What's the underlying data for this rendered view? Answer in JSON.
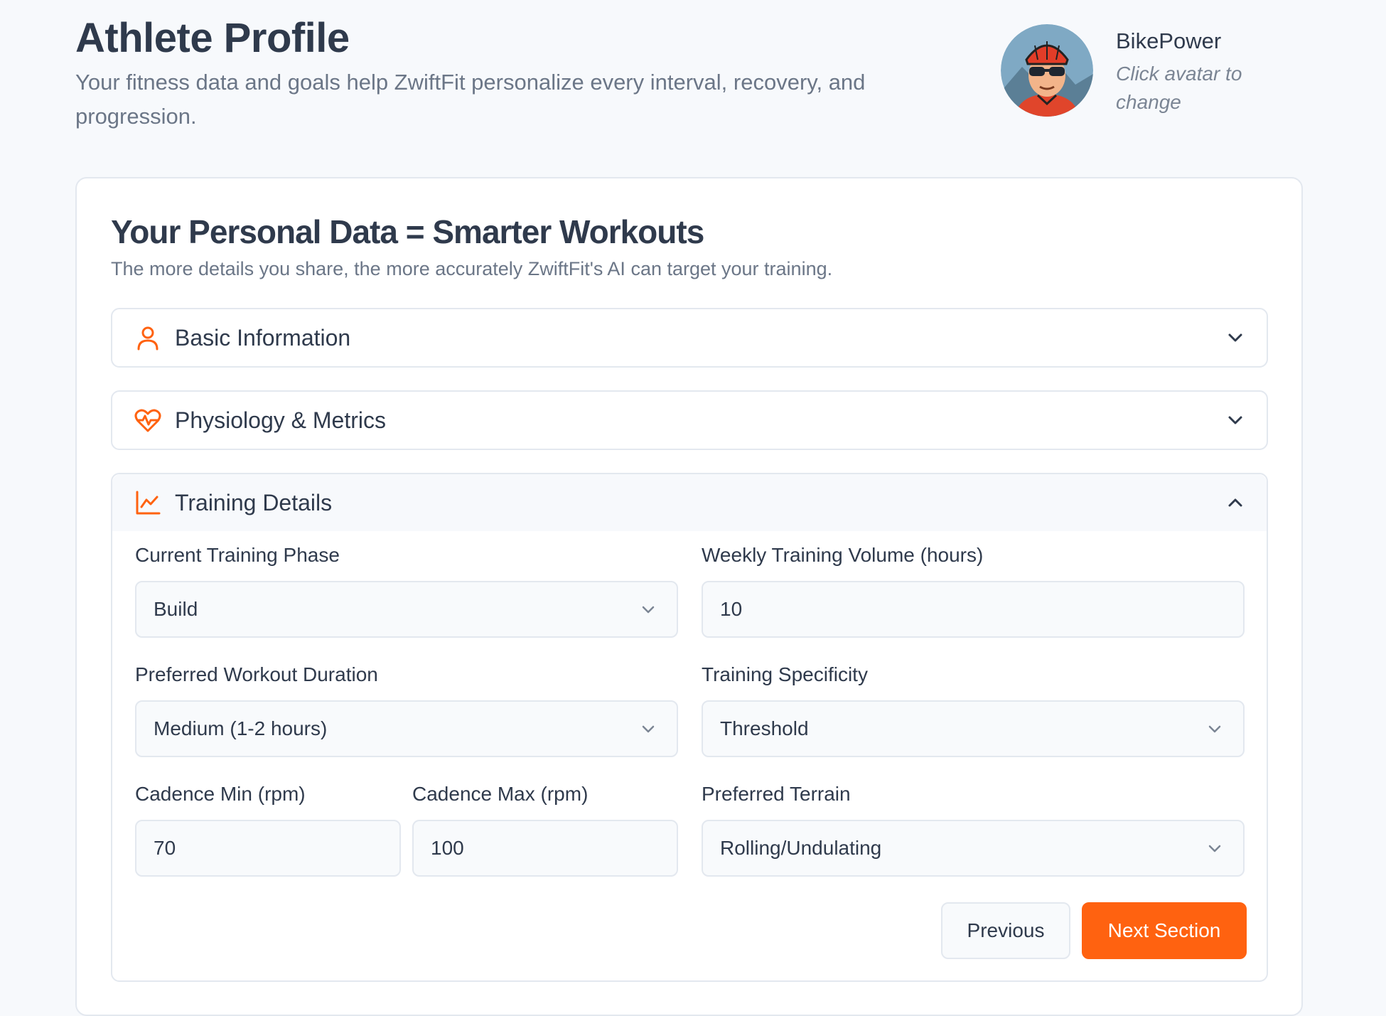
{
  "header": {
    "title": "Athlete Profile",
    "subtitle": "Your fitness data and goals help ZwiftFit personalize every interval, recovery, and progression."
  },
  "profile": {
    "username": "BikePower",
    "avatar_hint": "Click avatar to change"
  },
  "card": {
    "title": "Your Personal Data = Smarter Workouts",
    "subtitle": "The more details you share, the more accurately ZwiftFit's AI can target your training."
  },
  "sections": {
    "basic": {
      "label": "Basic Information",
      "icon": "user-icon",
      "expanded": false
    },
    "physiology": {
      "label": "Physiology & Metrics",
      "icon": "heart-pulse-icon",
      "expanded": false
    },
    "training": {
      "label": "Training Details",
      "icon": "line-chart-icon",
      "expanded": true
    }
  },
  "training": {
    "phase": {
      "label": "Current Training Phase",
      "value": "Build"
    },
    "weekly_volume": {
      "label": "Weekly Training Volume (hours)",
      "value": "10"
    },
    "duration": {
      "label": "Preferred Workout Duration",
      "value": "Medium (1-2 hours)"
    },
    "specificity": {
      "label": "Training Specificity",
      "value": "Threshold"
    },
    "cadence_min": {
      "label": "Cadence Min (rpm)",
      "value": "70"
    },
    "cadence_max": {
      "label": "Cadence Max (rpm)",
      "value": "100"
    },
    "terrain": {
      "label": "Preferred Terrain",
      "value": "Rolling/Undulating"
    }
  },
  "actions": {
    "previous_label": "Previous",
    "next_label": "Next Section"
  },
  "colors": {
    "accent": "#ff6210",
    "text": "#2f3a4c",
    "muted": "#6b7687",
    "border": "#e3e8ef"
  }
}
